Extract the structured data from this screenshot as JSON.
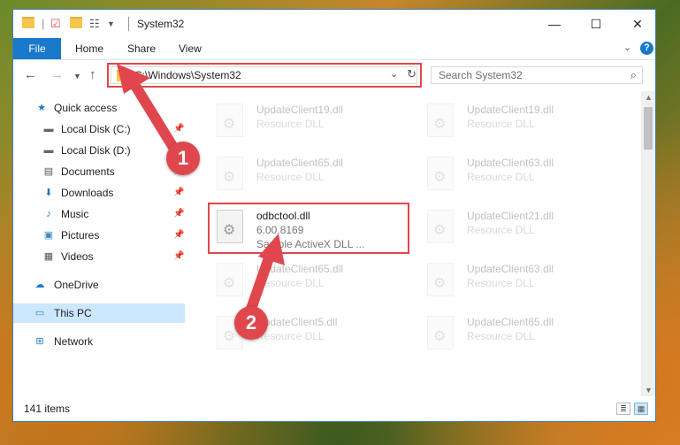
{
  "window": {
    "title": "System32",
    "controls": {
      "minimize": "—",
      "maximize": "☐",
      "close": "✕"
    }
  },
  "ribbon": {
    "tabs": [
      "File",
      "Home",
      "Share",
      "View"
    ],
    "help": "?"
  },
  "address": {
    "path": "C:\\Windows\\System32",
    "search_placeholder": "Search System32"
  },
  "sidebar": {
    "items": [
      {
        "label": "Quick access",
        "icon": "star-icon"
      },
      {
        "label": "Local Disk (C:)",
        "icon": "drive-icon",
        "pinned": true
      },
      {
        "label": "Local Disk (D:)",
        "icon": "drive-icon"
      },
      {
        "label": "Documents",
        "icon": "documents-icon",
        "pinned": true
      },
      {
        "label": "Downloads",
        "icon": "downloads-icon",
        "pinned": true
      },
      {
        "label": "Music",
        "icon": "music-icon",
        "pinned": true
      },
      {
        "label": "Pictures",
        "icon": "pictures-icon",
        "pinned": true
      },
      {
        "label": "Videos",
        "icon": "videos-icon",
        "pinned": true
      },
      {
        "label": "OneDrive",
        "icon": "cloud-icon"
      },
      {
        "label": "This PC",
        "icon": "computer-icon",
        "selected": true
      },
      {
        "label": "Network",
        "icon": "network-icon"
      }
    ]
  },
  "files": {
    "left": [
      {
        "name": "UpdateClient19.dll",
        "type": "Resource DLL",
        "faded": true
      },
      {
        "name": "UpdateClient65.dll",
        "type": "Resource DLL",
        "faded": true
      },
      {
        "name": "odbctool.dll",
        "version": "6.00.8169",
        "type": "Sample ActiveX DLL ...",
        "faded": false
      },
      {
        "name": "UpdateClient65.dll",
        "type": "Resource DLL",
        "faded": true
      },
      {
        "name": "UpdateClient5.dll",
        "type": "Resource DLL",
        "faded": true
      }
    ],
    "right": [
      {
        "name": "UpdateClient19.dll",
        "type": "Resource DLL",
        "faded": true
      },
      {
        "name": "UpdateClient63.dll",
        "type": "Resource DLL",
        "faded": true
      },
      {
        "name": "UpdateClient21.dll",
        "type": "Resource DLL",
        "faded": true
      },
      {
        "name": "UpdateClient63.dll",
        "type": "Resource DLL",
        "faded": true
      },
      {
        "name": "UpdateClient65.dll",
        "type": "Resource DLL",
        "faded": true
      }
    ]
  },
  "status": {
    "count": "141 items"
  },
  "annotations": {
    "step1": "1",
    "step2": "2"
  },
  "colors": {
    "accent": "#1979ca",
    "highlight": "#e0474c",
    "selected": "#cce8ff"
  }
}
